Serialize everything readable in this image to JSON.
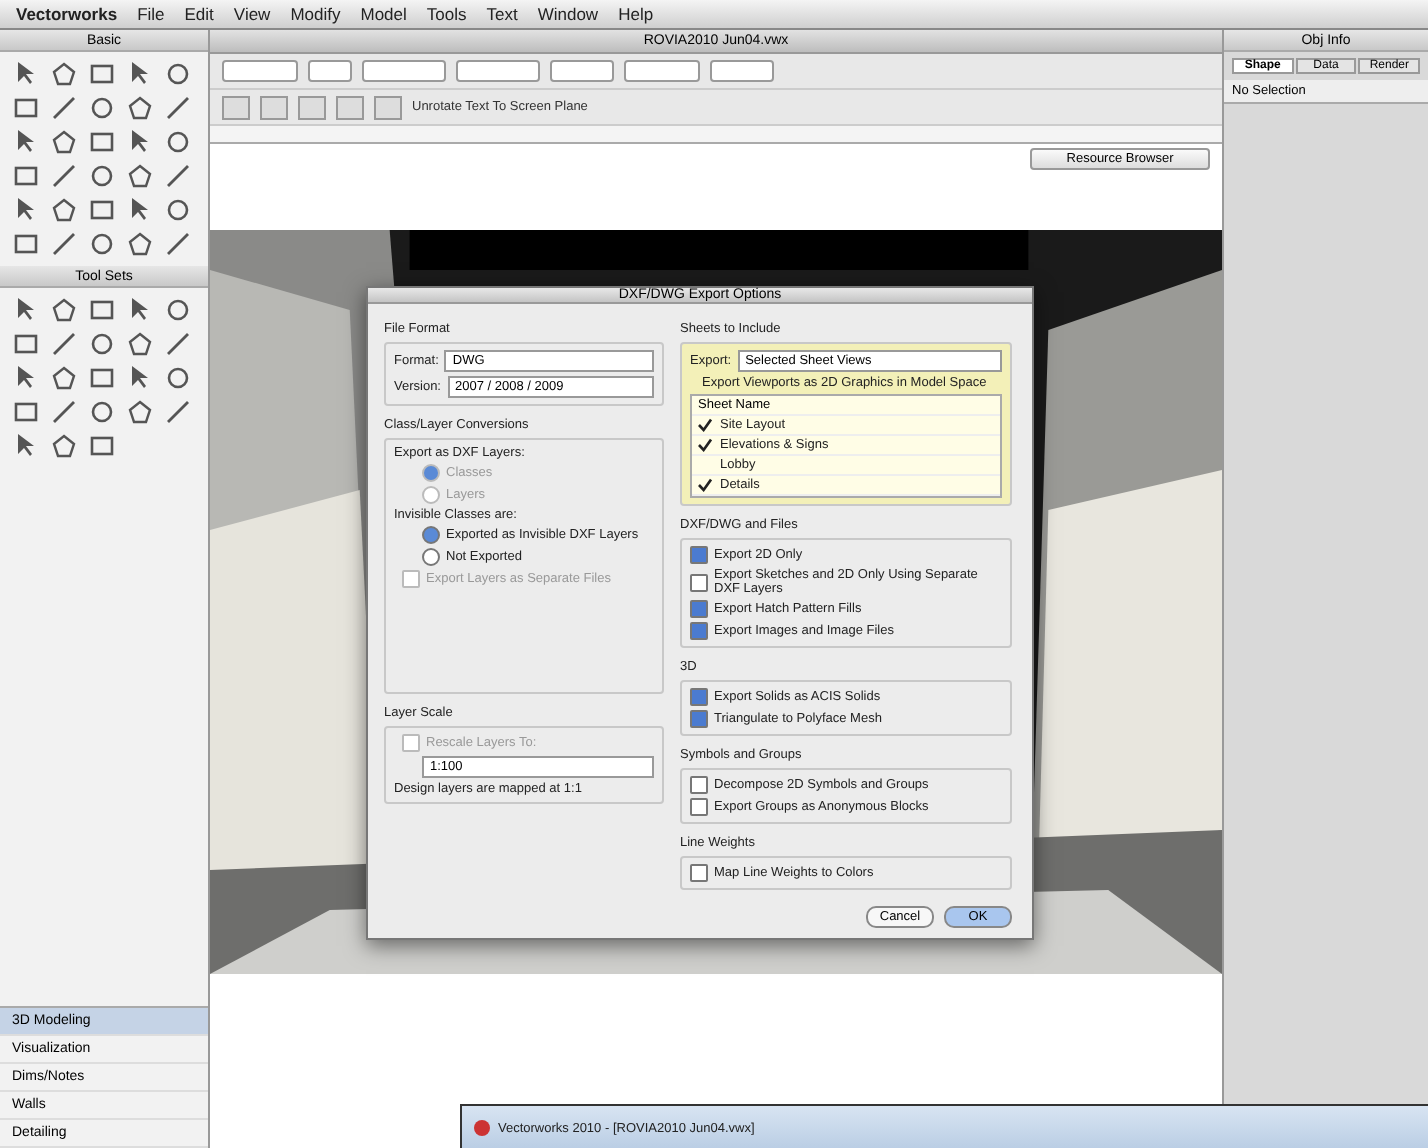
{
  "menu_bar": {
    "items": [
      "Vectorworks",
      "File",
      "Edit",
      "View",
      "Modify",
      "Model",
      "Tools",
      "Text",
      "Window",
      "Help"
    ]
  },
  "document": {
    "title": "ROVIA2010 Jun04.vwx",
    "unrotate_label": "Unrotate Text To Screen Plane",
    "resource_button": "Resource Browser"
  },
  "left_palette": {
    "basic_title": "Basic",
    "tool_sets_title": "Tool Sets",
    "workspaces": [
      {
        "label": "3D Modeling",
        "selected": true
      },
      {
        "label": "Visualization",
        "selected": false
      },
      {
        "label": "Dims/Notes",
        "selected": false
      },
      {
        "label": "Walls",
        "selected": false
      },
      {
        "label": "Detailing",
        "selected": false
      }
    ]
  },
  "obj_info": {
    "title": "Obj Info",
    "tabs": [
      {
        "label": "Shape",
        "selected": true
      },
      {
        "label": "Data",
        "selected": false
      },
      {
        "label": "Render",
        "selected": false
      }
    ],
    "status": "No Selection"
  },
  "dialog": {
    "title": "DXF/DWG Export Options",
    "file_format": {
      "heading": "File Format",
      "format_label": "Format:",
      "format_value": "DWG",
      "version_label": "Version:",
      "version_value": "2007 / 2008 / 2009"
    },
    "class_layer": {
      "heading": "Class/Layer Conversions",
      "export_as": "Export as DXF Layers:",
      "radios": [
        {
          "label": "Classes",
          "selected": true,
          "disabled": true
        },
        {
          "label": "Layers",
          "selected": false,
          "disabled": true
        }
      ],
      "invisible_heading": "Invisible Classes are:",
      "invisible_options": [
        {
          "label": "Exported as Invisible DXF Layers",
          "selected": true
        },
        {
          "label": "Not Exported",
          "selected": false
        }
      ],
      "separate_files": {
        "label": "Export Layers as Separate Files",
        "checked": false,
        "disabled": true
      }
    },
    "layer_scale": {
      "heading": "Layer Scale",
      "rescale": {
        "label": "Rescale Layers To:",
        "checked": false,
        "disabled": true
      },
      "scale_value": "1:100",
      "note": "Design layers are mapped at 1:1"
    },
    "sheets": {
      "heading": "Sheets to Include",
      "export_label": "Export:",
      "export_value": "Selected Sheet Views",
      "viewports_label": "Export Viewports as 2D Graphics in Model Space",
      "list_header": "Sheet Name",
      "items": [
        {
          "label": "Site Layout",
          "checked": true
        },
        {
          "label": "Elevations & Signs",
          "checked": true
        },
        {
          "label": "Lobby",
          "checked": false
        },
        {
          "label": "Details",
          "checked": true
        }
      ]
    },
    "groups": [
      {
        "heading": "DXF/DWG and Files",
        "options": [
          {
            "label": "Export 2D Only",
            "checked": true
          },
          {
            "label": "Export Sketches and 2D Only Using Separate DXF Layers",
            "checked": false
          },
          {
            "label": "Export Hatch Pattern Fills",
            "checked": true
          },
          {
            "label": "Export Images and Image Files",
            "checked": true
          }
        ]
      },
      {
        "heading": "3D",
        "options": [
          {
            "label": "Export Solids as ACIS Solids",
            "checked": true
          },
          {
            "label": "Triangulate to Polyface Mesh",
            "checked": true
          }
        ]
      },
      {
        "heading": "Symbols and Groups",
        "options": [
          {
            "label": "Decompose 2D Symbols and Groups",
            "checked": false
          },
          {
            "label": "Export Groups as Anonymous Blocks",
            "checked": false
          }
        ]
      },
      {
        "heading": "Line Weights",
        "options": [
          {
            "label": "Map Line Weights to Colors",
            "checked": false
          }
        ]
      }
    ],
    "buttons": [
      {
        "label": "Cancel",
        "default": false
      },
      {
        "label": "OK",
        "default": true
      }
    ]
  },
  "background_window": {
    "title": "Vectorworks 2010 - [ROVIA2010 Jun04.vwx]"
  }
}
